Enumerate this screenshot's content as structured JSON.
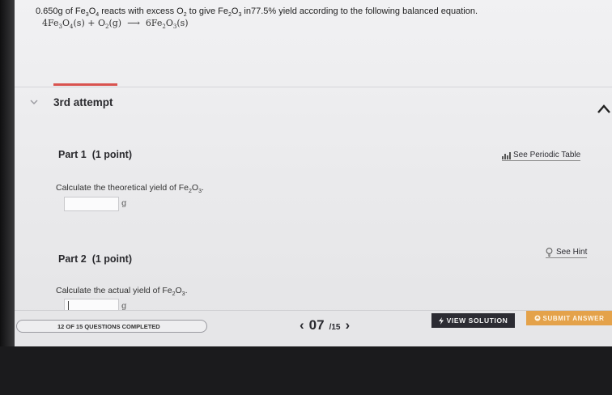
{
  "question": {
    "mass": "0.650g of Fe",
    "mid1": " reacts with excess O",
    "mid2": " to give Fe",
    "mid3": " in77.5% yield according to the following balanced equation.",
    "sub3": "3",
    "sub4": "4",
    "sub2": "2"
  },
  "equation": {
    "lhs1": "4Fe",
    "lhs2": "O",
    "lhs3": "(s) + O",
    "lhs4": "(g)",
    "arrow": "⟶",
    "rhs1": "6Fe",
    "rhs2": "O",
    "rhs3": "(s)"
  },
  "attempt": {
    "label": "3rd attempt"
  },
  "part1": {
    "title": "Part 1",
    "points": "(1 point)",
    "prompt_a": "Calculate the theoretical yield of Fe",
    "prompt_b": "O",
    "prompt_c": ".",
    "unit": "g",
    "value": ""
  },
  "part2": {
    "title": "Part 2",
    "points": "(1 point)",
    "prompt_a": "Calculate the actual yield of Fe",
    "prompt_b": "O",
    "prompt_c": ".",
    "unit": "g",
    "value": ""
  },
  "links": {
    "periodic_table": "See Periodic Table",
    "hint": "See Hint"
  },
  "footer": {
    "progress_text": "12 OF 15 QUESTIONS COMPLETED",
    "progress_fraction": 0.8,
    "page_current": "07",
    "page_total": "/15",
    "prev": "‹",
    "next": "›",
    "view_solution": "VIEW SOLUTION",
    "submit_answer": "SUBMIT ANSWER"
  },
  "colors": {
    "accent": "#d9534f",
    "submit": "#e4a24a",
    "solution": "#2c2c33"
  }
}
